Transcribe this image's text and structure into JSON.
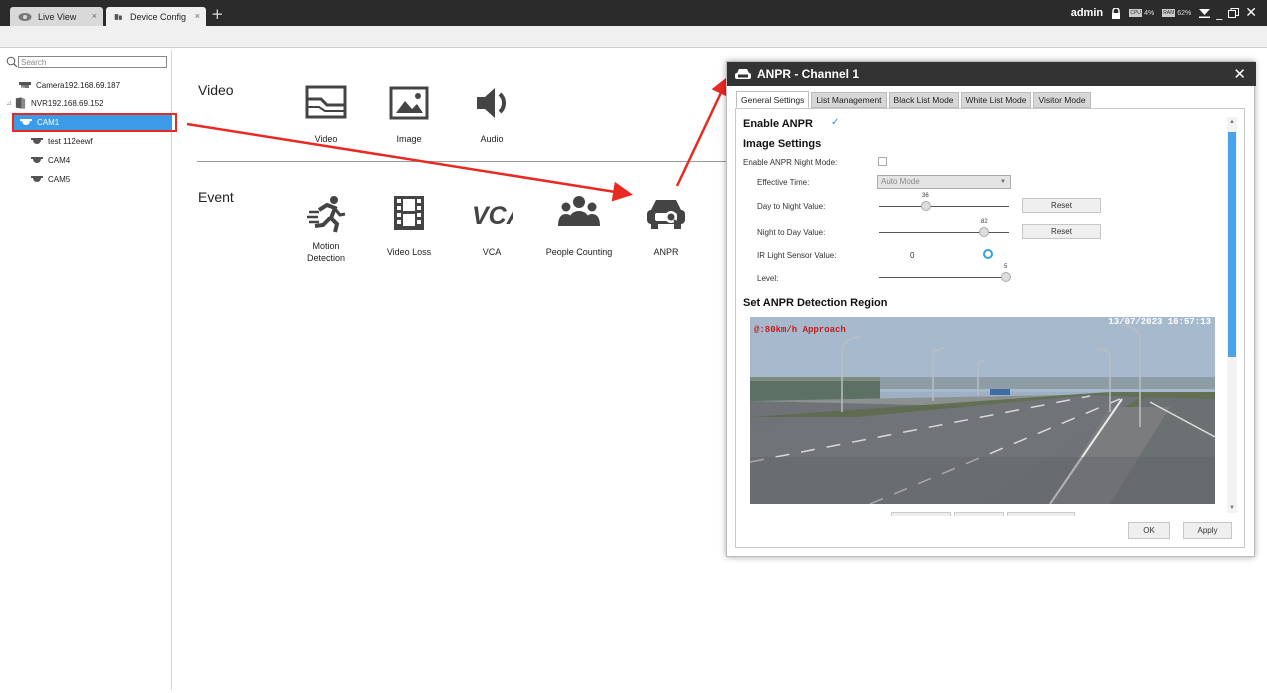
{
  "tabs": [
    {
      "label": "Live View",
      "close": "×",
      "icon": "eye-icon"
    },
    {
      "label": "Device Config",
      "close": "×",
      "icon": "device-config-icon"
    }
  ],
  "tab_add": "+",
  "topbar": {
    "user": "admin",
    "cpu_label": "CPU",
    "cpu_value": "4%",
    "ram_label": "RAM",
    "ram_value": "62%",
    "icons": [
      "lock-icon",
      "filter-icon",
      "minimize-icon",
      "restore-icon",
      "close-icon"
    ]
  },
  "sidebar": {
    "search_placeholder": "Search",
    "items": [
      {
        "label": "Camera192.168.69.187",
        "icon": "camera-icon"
      },
      {
        "label": "NVR192.168.69.152",
        "icon": "nvr-icon",
        "expander": "⊿"
      },
      {
        "label": "CAM1",
        "icon": "dome-camera-icon",
        "selected": true
      },
      {
        "label": "test 112eewf",
        "icon": "dome-camera-icon"
      },
      {
        "label": "CAM4",
        "icon": "dome-camera-icon"
      },
      {
        "label": "CAM5",
        "icon": "dome-camera-icon"
      }
    ]
  },
  "main": {
    "video_section": "Video",
    "event_section": "Event",
    "video_funcs": [
      "Video",
      "Image",
      "Audio"
    ],
    "event_funcs": [
      "Motion Detection",
      "Video Loss",
      "VCA",
      "People Counting",
      "ANPR"
    ],
    "vca_glyph": "VCA"
  },
  "dialog": {
    "title": "ANPR - Channel 1",
    "close": "✕",
    "tabs": [
      "General Settings",
      "List Management",
      "Black List Mode",
      "White List Mode",
      "Visitor Mode"
    ],
    "enable_anpr": "Enable ANPR",
    "enable_anpr_checked": true,
    "image_settings": "Image Settings",
    "night_mode_label": "Enable ANPR Night Mode:",
    "effective_time_label": "Effective Time:",
    "effective_time_value": "Auto Mode",
    "day_to_night_label": "Day to Night Value:",
    "day_to_night_value": "36",
    "night_to_day_label": "Night to Day Value:",
    "night_to_day_value": "82",
    "ir_label": "IR Light Sensor Value:",
    "ir_value": "0",
    "level_label": "Level:",
    "level_value": "5",
    "reset": "Reset",
    "detection_region": "Set ANPR Detection Region",
    "video_overlay_left": "@:80km/h Approach",
    "video_overlay_right": "13/07/2023 16:57:13",
    "ok": "OK",
    "apply": "Apply"
  },
  "colors": {
    "accent": "#3b9be8",
    "annotation_red": "#e82a23",
    "titlebar": "#333333"
  }
}
